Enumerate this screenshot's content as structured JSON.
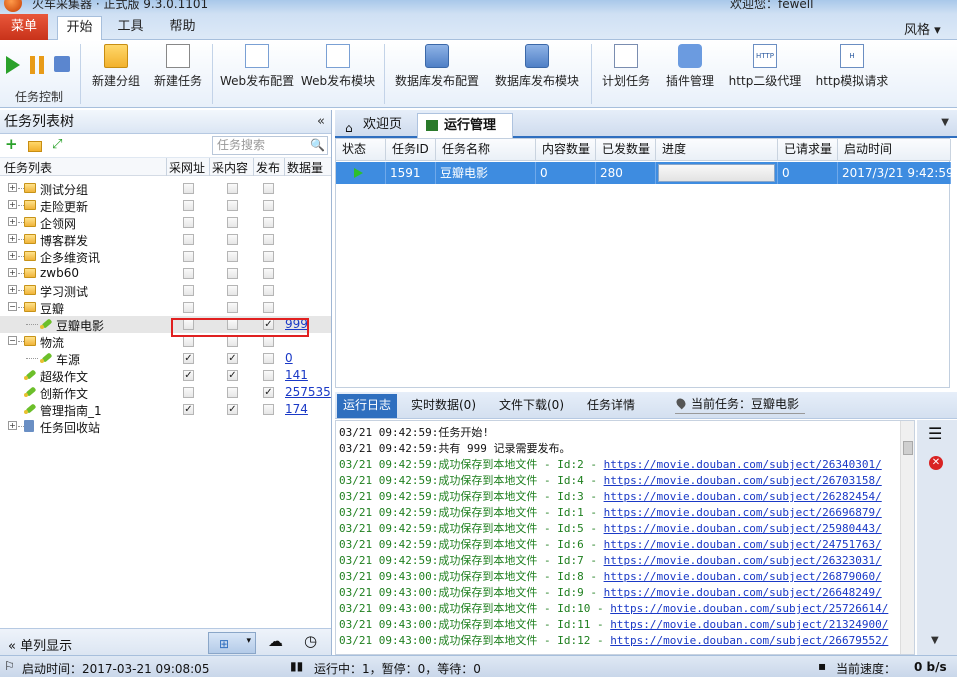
{
  "window": {
    "title": "火车采集器 · 正式版 9.3.0.1101",
    "user": "欢迎您：fewell"
  },
  "menu": {
    "menu_label": "菜单",
    "tabs": [
      "开始",
      "工具",
      "帮助"
    ],
    "style_label": "风格"
  },
  "ribbon": {
    "task_control_label": "任务控制",
    "buttons": [
      "新建分组",
      "新建任务",
      "Web发布配置",
      "Web发布模块",
      "数据库发布配置",
      "数据库发布模块",
      "计划任务",
      "插件管理",
      "http二级代理",
      "http模拟请求"
    ]
  },
  "left": {
    "title": "任务列表树",
    "search_placeholder": "任务搜索",
    "columns": [
      "任务列表",
      "采网址",
      "采内容",
      "发布",
      "数据量"
    ],
    "footer_label": "单列显示"
  },
  "tree": [
    {
      "label": "测试分组",
      "type": "folder",
      "expanded": false,
      "c1": false,
      "c2": false,
      "c3": false,
      "count": ""
    },
    {
      "label": "走险更新",
      "type": "folder",
      "expanded": false,
      "c1": false,
      "c2": false,
      "c3": false,
      "count": ""
    },
    {
      "label": "企领网",
      "type": "folder",
      "expanded": false,
      "c1": false,
      "c2": false,
      "c3": false,
      "count": ""
    },
    {
      "label": "博客群发",
      "type": "folder",
      "expanded": false,
      "c1": false,
      "c2": false,
      "c3": false,
      "count": ""
    },
    {
      "label": "企多维资讯",
      "type": "folder",
      "expanded": false,
      "c1": false,
      "c2": false,
      "c3": false,
      "count": ""
    },
    {
      "label": "zwb60",
      "type": "folder",
      "expanded": false,
      "c1": false,
      "c2": false,
      "c3": false,
      "count": ""
    },
    {
      "label": "学习测试",
      "type": "folder",
      "expanded": false,
      "c1": false,
      "c2": false,
      "c3": false,
      "count": ""
    },
    {
      "label": "豆瓣",
      "type": "folder",
      "expanded": true,
      "c1": false,
      "c2": false,
      "c3": false,
      "count": ""
    },
    {
      "label": "豆瓣电影",
      "type": "task",
      "child": true,
      "selected": true,
      "c1": false,
      "c2": false,
      "c3": true,
      "count": "999"
    },
    {
      "label": "物流",
      "type": "folder",
      "expanded": true,
      "c1": false,
      "c2": false,
      "c3": false,
      "count": ""
    },
    {
      "label": "车源",
      "type": "task",
      "child": true,
      "c1": true,
      "c2": true,
      "c3": false,
      "count": "0"
    },
    {
      "label": "超级作文",
      "type": "task",
      "c1": true,
      "c2": true,
      "c3": false,
      "count": "141"
    },
    {
      "label": "创新作文",
      "type": "task",
      "c1": false,
      "c2": false,
      "c3": true,
      "count": "257535"
    },
    {
      "label": "管理指南_1",
      "type": "task",
      "c1": true,
      "c2": true,
      "c3": false,
      "count": "174"
    },
    {
      "label": "任务回收站",
      "type": "trash",
      "expanded": false,
      "c1": null,
      "c2": null,
      "c3": null,
      "count": ""
    }
  ],
  "doc_tabs": [
    "欢迎页",
    "运行管理"
  ],
  "grid": {
    "columns": [
      "状态",
      "任务ID",
      "任务名称",
      "内容数量",
      "已发数量",
      "进度",
      "已请求量",
      "启动时间"
    ],
    "row": {
      "id": "1591",
      "name": "豆瓣电影",
      "content": "0",
      "published": "280",
      "progress": 0.0,
      "requested": "0",
      "start": "2017/3/21 9:42:59"
    }
  },
  "log": {
    "tabs": [
      "运行日志",
      "实时数据(0)",
      "文件下载(0)",
      "任务详情"
    ],
    "current_task": "当前任务：豆瓣电影",
    "lines": [
      {
        "text": "03/21 09:42:59:任务开始!",
        "url": "",
        "color": "black"
      },
      {
        "text": "03/21 09:42:59:共有 999 记录需要发布。",
        "url": "",
        "color": "black"
      },
      {
        "text": "03/21 09:42:59:成功保存到本地文件 - Id:2 - ",
        "url": "https://movie.douban.com/subject/26340301/",
        "color": "green"
      },
      {
        "text": "03/21 09:42:59:成功保存到本地文件 - Id:4 - ",
        "url": "https://movie.douban.com/subject/26703158/",
        "color": "green"
      },
      {
        "text": "03/21 09:42:59:成功保存到本地文件 - Id:3 - ",
        "url": "https://movie.douban.com/subject/26282454/",
        "color": "green"
      },
      {
        "text": "03/21 09:42:59:成功保存到本地文件 - Id:1 - ",
        "url": "https://movie.douban.com/subject/26696879/",
        "color": "green"
      },
      {
        "text": "03/21 09:42:59:成功保存到本地文件 - Id:5 - ",
        "url": "https://movie.douban.com/subject/25980443/",
        "color": "green"
      },
      {
        "text": "03/21 09:42:59:成功保存到本地文件 - Id:6 - ",
        "url": "https://movie.douban.com/subject/24751763/",
        "color": "green"
      },
      {
        "text": "03/21 09:42:59:成功保存到本地文件 - Id:7 - ",
        "url": "https://movie.douban.com/subject/26323031/",
        "color": "green"
      },
      {
        "text": "03/21 09:43:00:成功保存到本地文件 - Id:8 - ",
        "url": "https://movie.douban.com/subject/26879060/",
        "color": "green"
      },
      {
        "text": "03/21 09:43:00:成功保存到本地文件 - Id:9 - ",
        "url": "https://movie.douban.com/subject/26648249/",
        "color": "green"
      },
      {
        "text": "03/21 09:43:00:成功保存到本地文件 - Id:10 - ",
        "url": "https://movie.douban.com/subject/25726614/",
        "color": "green"
      },
      {
        "text": "03/21 09:43:00:成功保存到本地文件 - Id:11 - ",
        "url": "https://movie.douban.com/subject/21324900/",
        "color": "green"
      },
      {
        "text": "03/21 09:43:00:成功保存到本地文件 - Id:12 - ",
        "url": "https://movie.douban.com/subject/26679552/",
        "color": "green"
      }
    ]
  },
  "status": {
    "start_time": "启动时间：2017-03-21 09:08:05",
    "running": "运行中：1，暂停：0，等待：0",
    "speed_label": "当前速度：",
    "speed_value": "0 b/s"
  },
  "colors": {
    "accent": "#2f6fbf",
    "selected_row": "#3e8ce0",
    "menu_button": "#d9432a",
    "highlight_box": "#e02020"
  }
}
